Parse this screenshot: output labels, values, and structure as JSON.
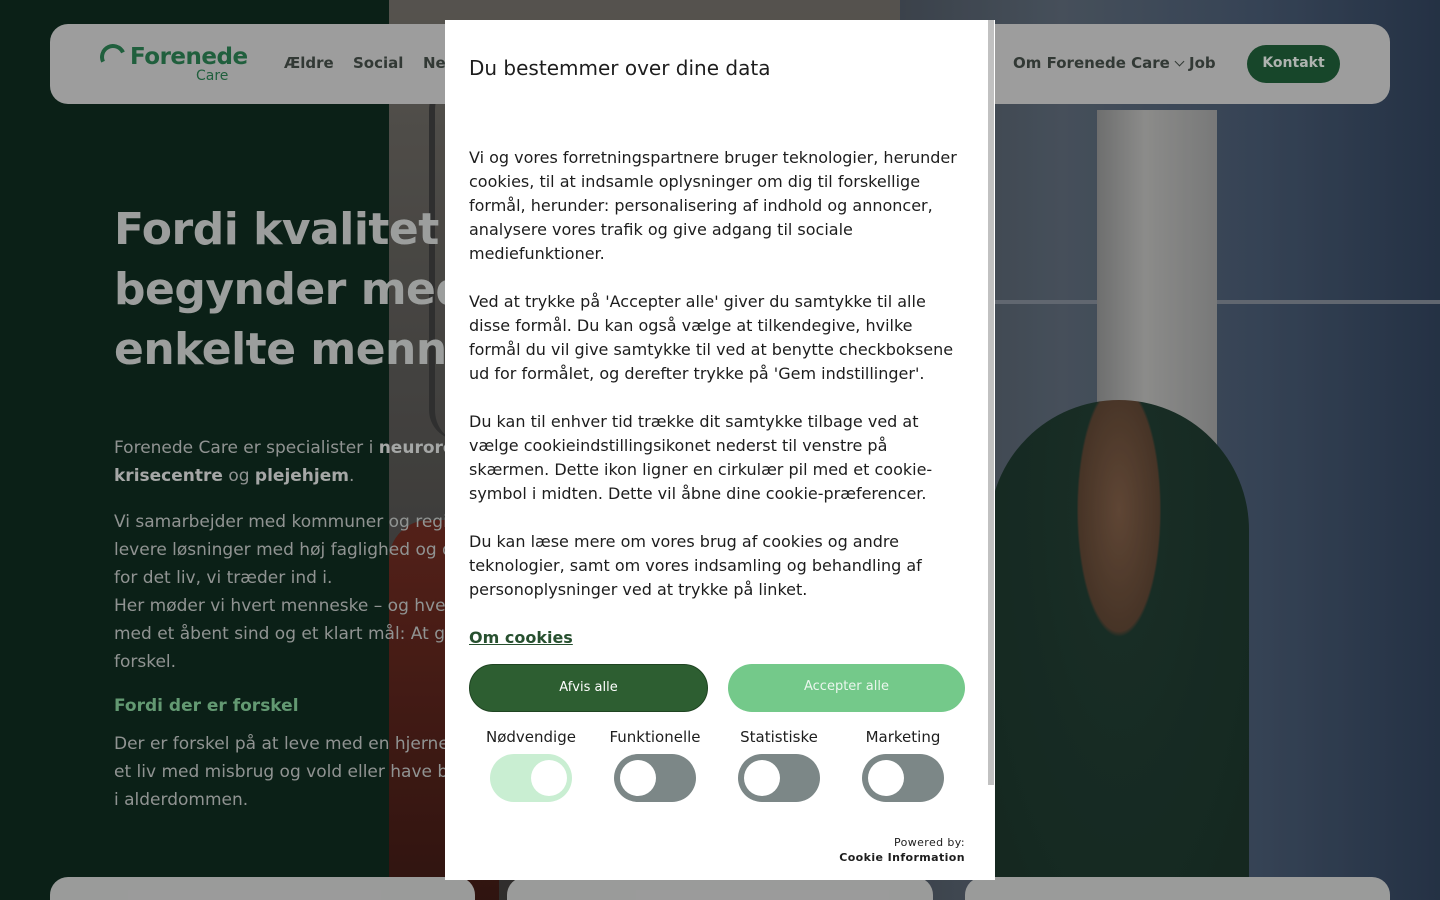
{
  "nav": {
    "logo_word": "Forenede",
    "logo_sub": "Care",
    "items": [
      "Ældre",
      "Social",
      "Ne",
      "Om Forenede Care",
      "Job"
    ],
    "contact_label": "Kontakt"
  },
  "hero": {
    "title_lines": [
      "Fordi kvalitet i ve",
      "begynder med n",
      "enkelte mennesk"
    ],
    "p1_a": "Forenede Care er specialister i ",
    "p1_b": "neurorehab",
    "p1_c": "krisecentre",
    "p1_d": " og ",
    "p1_e": "plejehjem",
    "p1_f": ".",
    "p2_lines": [
      "Vi samarbejder med kommuner og region",
      "levere løsninger med høj faglighed og dy",
      "for det liv, vi træder ind i.",
      "Her møder vi hvert menneske – og hver o",
      "med et åbent sind og et klart mål: At gør",
      "forskel."
    ],
    "subheading": "Fordi der er forskel",
    "p3_lines": [
      "Der er forskel på at leve med en hjernesk",
      "et liv med misbrug og vold eller have bru",
      "i alderdommen."
    ]
  },
  "consent": {
    "title": "Du bestemmer over dine data",
    "paragraphs": [
      "Vi og vores forretningspartnere bruger teknologier, herunder cookies, til at indsamle oplysninger om dig til forskellige formål, herunder: personalisering af indhold og annoncer, analysere vores trafik og give adgang til sociale mediefunktioner.",
      "Ved at trykke på 'Accepter alle' giver du samtykke til alle disse formål. Du kan også vælge at tilkendegive, hvilke formål du vil give samtykke til ved at benytte checkboksene ud for formålet, og derefter trykke på 'Gem indstillinger'.",
      "Du kan til enhver tid trække dit samtykke tilbage ved at vælge cookieindstillingsikonet nederst til venstre på skærmen. Dette ikon ligner en cirkulær pil med et cookie-symbol i midten. Dette vil åbne dine cookie-præferencer.",
      "Du kan læse mere om vores brug af cookies og andre teknologier, samt om vores indsamling og behandling af personoplysninger ved at trykke på linket."
    ],
    "link": "Om cookies",
    "reject_label": "Afvis alle",
    "accept_label": "Accepter alle",
    "toggles": [
      {
        "label": "Nødvendige",
        "on": true
      },
      {
        "label": "Funktionelle",
        "on": false
      },
      {
        "label": "Statistiske",
        "on": false
      },
      {
        "label": "Marketing",
        "on": false
      }
    ],
    "powered_by": "Powered by:",
    "powered_name": "Cookie Information"
  },
  "colors": {
    "brand_green": "#2a7a4f",
    "button_dark": "#2d5e31",
    "button_light": "#74c98a"
  }
}
